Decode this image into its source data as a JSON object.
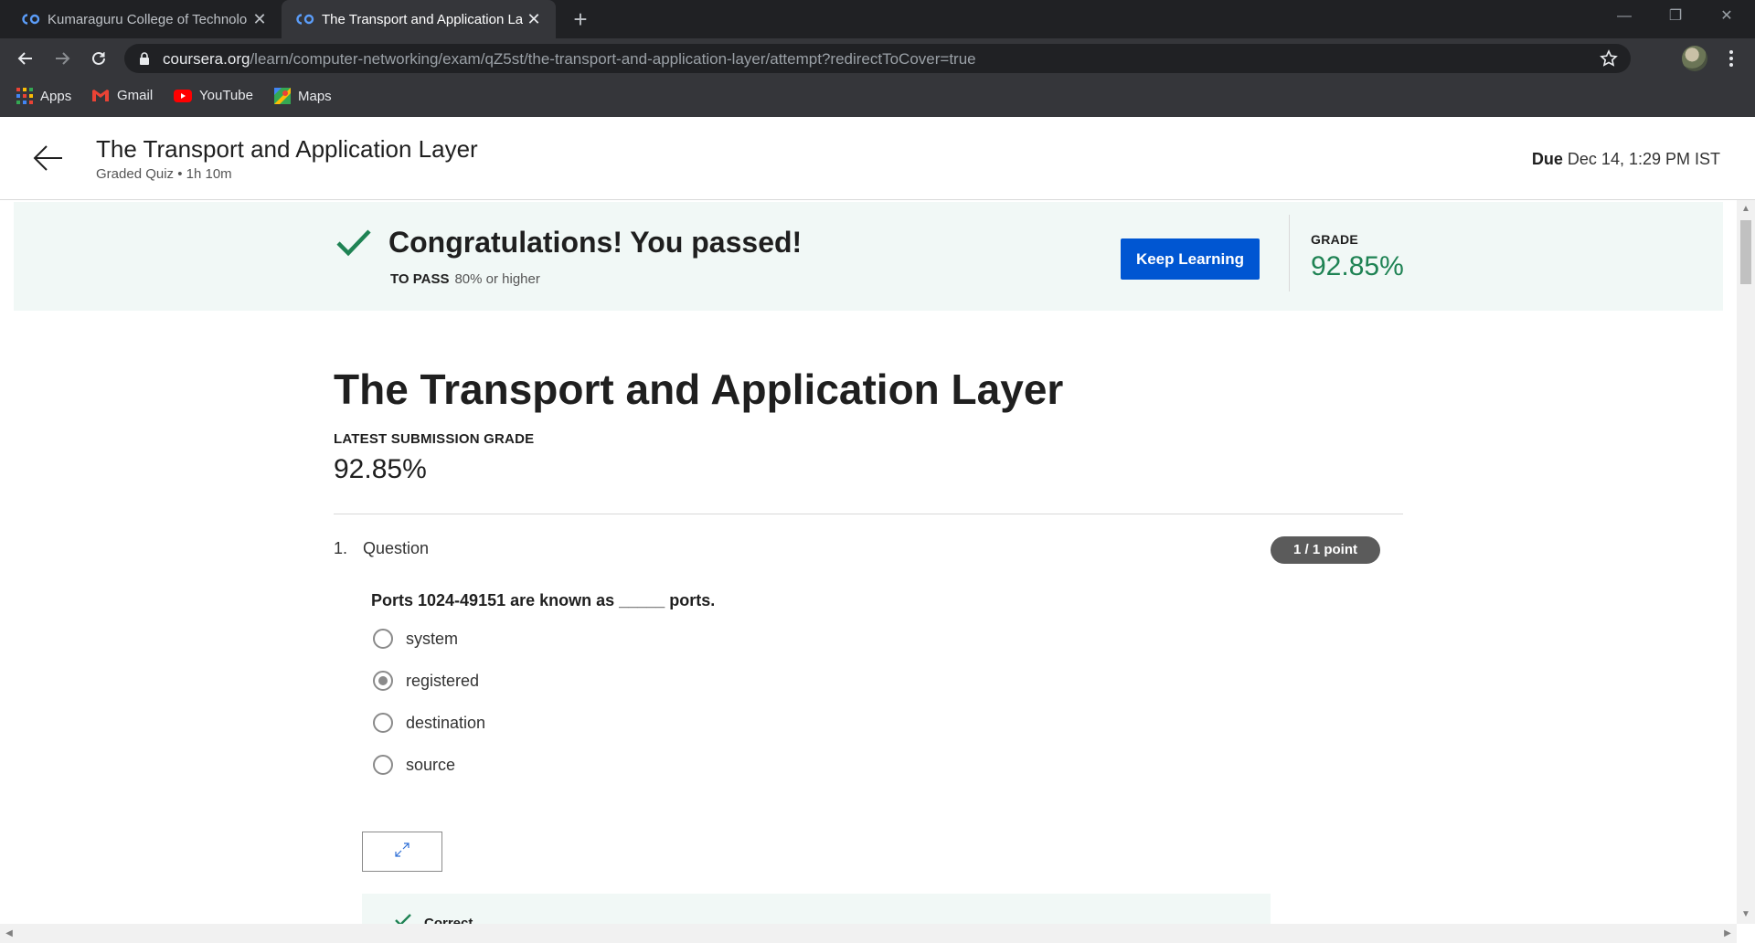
{
  "browser": {
    "tabs": [
      {
        "title": "Kumaraguru College of Technolo",
        "icon": "coursera-icon",
        "active": false
      },
      {
        "title": "The Transport and Application La",
        "icon": "coursera-icon",
        "active": true
      }
    ],
    "url_host": "coursera.org",
    "url_path": "/learn/computer-networking/exam/qZ5st/the-transport-and-application-layer/attempt?redirectToCover=true",
    "bookmarks": [
      {
        "label": "Apps",
        "icon": "apps-grid-icon"
      },
      {
        "label": "Gmail",
        "icon": "gmail-icon"
      },
      {
        "label": "YouTube",
        "icon": "youtube-icon"
      },
      {
        "label": "Maps",
        "icon": "maps-icon"
      }
    ]
  },
  "header": {
    "title": "The Transport and Application Layer",
    "subtitle": "Graded Quiz • 1h 10m",
    "due_label": "Due",
    "due_value": "Dec 14, 1:29 PM IST"
  },
  "banner": {
    "message": "Congratulations! You passed!",
    "to_pass_label": "TO PASS",
    "to_pass_value": "80% or higher",
    "button": "Keep Learning",
    "grade_label": "GRADE",
    "grade_value": "92.85%"
  },
  "quiz": {
    "title": "The Transport and Application Layer",
    "latest_label": "LATEST SUBMISSION GRADE",
    "latest_value": "92.85%"
  },
  "question": {
    "number": "1.",
    "label": "Question",
    "points": "1 / 1 point",
    "text": "Ports 1024-49151 are known as _____ ports.",
    "options": [
      "system",
      "registered",
      "destination",
      "source"
    ],
    "selected_index": 1,
    "feedback": "Correct"
  },
  "colors": {
    "accent": "#0056d2",
    "success": "#1f8354",
    "banner_bg": "#f1f8f6"
  }
}
